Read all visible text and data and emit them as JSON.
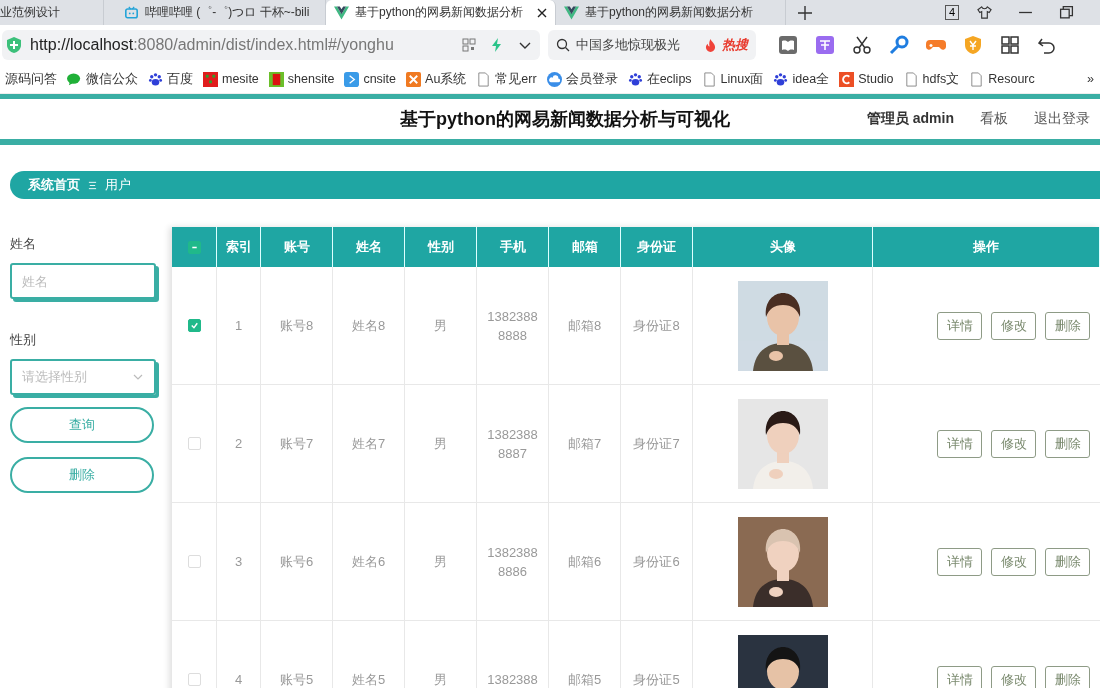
{
  "browser": {
    "tabs": [
      {
        "title": "业范例设计",
        "kind": "plain",
        "selected": false
      },
      {
        "title": "哔哩哔哩 (゜-゜)つロ 干杯~-bili",
        "kind": "video",
        "selected": false
      },
      {
        "title": "基于python的网易新闻数据分析",
        "kind": "app",
        "selected": true
      },
      {
        "title": "基于python的网易新闻数据分析",
        "kind": "app",
        "selected": false
      }
    ],
    "tab_count": "4",
    "address": {
      "host": "http://localhost",
      "path": ":8080/admin/dist/index.html#/yonghu"
    },
    "search": {
      "value": "中国多地惊现极光",
      "hot": "热搜"
    },
    "bookmarks": [
      {
        "label": "源码问答",
        "kind": "none"
      },
      {
        "label": "微信公众",
        "kind": "chat"
      },
      {
        "label": "百度",
        "kind": "paw"
      },
      {
        "label": "mesite",
        "kind": "grid"
      },
      {
        "label": "shensite",
        "kind": "shen"
      },
      {
        "label": "cnsite",
        "kind": "play"
      },
      {
        "label": "Au系统",
        "kind": "au"
      },
      {
        "label": "常见err",
        "kind": "doc"
      },
      {
        "label": "会员登录",
        "kind": "cloud"
      },
      {
        "label": "在eclips",
        "kind": "paw"
      },
      {
        "label": "Linux面",
        "kind": "doc"
      },
      {
        "label": "idea全",
        "kind": "paw"
      },
      {
        "label": "Studio",
        "kind": "c"
      },
      {
        "label": "hdfs文",
        "kind": "doc"
      },
      {
        "label": "Resourc",
        "kind": "doc"
      }
    ],
    "more": "»"
  },
  "header": {
    "title": "基于python的网易新闻数据分析与可视化",
    "user": "管理员 admin",
    "links": [
      "看板",
      "退出登录"
    ]
  },
  "breadcrumb": {
    "home": "系统首页",
    "current": "用户"
  },
  "filters": [
    {
      "label": "姓名",
      "kind": "input",
      "placeholder": "姓名"
    },
    {
      "label": "性别",
      "kind": "select",
      "placeholder": "请选择性别"
    }
  ],
  "buttons": [
    "查询",
    "删除"
  ],
  "table": {
    "select_all": {
      "indeterminate": true
    },
    "columns": [
      "索引",
      "账号",
      "姓名",
      "性别",
      "手机",
      "邮箱",
      "身份证",
      "头像",
      "操作"
    ],
    "rows": [
      {
        "selected": true,
        "cells": [
          "1",
          "账号8",
          "姓名8",
          "男",
          "13823888888",
          "邮箱8",
          "身份证8"
        ],
        "avatar": {
          "kind": "picture"
        },
        "actions": [
          "详情",
          "修改",
          "删除"
        ]
      },
      {
        "selected": false,
        "cells": [
          "2",
          "账号7",
          "姓名7",
          "男",
          "13823888887",
          "邮箱7",
          "身份证7"
        ],
        "avatar": {
          "kind": "picture"
        },
        "actions": [
          "详情",
          "修改",
          "删除"
        ]
      },
      {
        "selected": false,
        "cells": [
          "3",
          "账号6",
          "姓名6",
          "男",
          "13823888886",
          "邮箱6",
          "身份证6"
        ],
        "avatar": {
          "kind": "picture"
        },
        "actions": [
          "详情",
          "修改",
          "删除"
        ]
      },
      {
        "selected": false,
        "cells": [
          "4",
          "账号5",
          "姓名5",
          "男",
          "1382388",
          "邮箱5",
          "身份证5"
        ],
        "avatar": {
          "kind": "picture"
        },
        "actions": [
          "详情",
          "修改",
          "删除"
        ]
      }
    ]
  }
}
